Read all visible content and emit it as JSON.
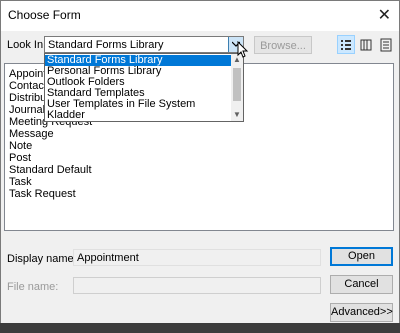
{
  "window": {
    "title": "Choose Form",
    "close_glyph": "✕"
  },
  "look_in": {
    "label": "Look In:",
    "value": "Standard Forms Library",
    "options": [
      "Standard Forms Library",
      "Personal Forms Library",
      "Outlook Folders",
      "Standard Templates",
      "User Templates in File System",
      "Kladder"
    ],
    "selected_index": 0
  },
  "browse_label": "Browse...",
  "view_buttons": [
    {
      "icon": "details-view-icon",
      "selected": true
    },
    {
      "icon": "list-view-icon",
      "selected": false
    },
    {
      "icon": "properties-view-icon",
      "selected": false
    }
  ],
  "forms_list": {
    "items": [
      "Appointment",
      "Contact",
      "Distribution List",
      "Journal Entry",
      "Meeting Request",
      "Message",
      "Note",
      "Post",
      "Standard Default",
      "Task",
      "Task Request"
    ],
    "obscured_texts": [
      "Appointn",
      "Contact",
      "Distributio",
      "Journal E",
      "Meeting Request"
    ]
  },
  "display_name": {
    "label": "Display name:",
    "value": "Appointment"
  },
  "file_name": {
    "label": "File name:",
    "value": ""
  },
  "buttons": {
    "open": "Open",
    "cancel": "Cancel",
    "advanced": "Advanced>>"
  },
  "colors": {
    "selection": "#0078d7",
    "default_button_border": "#0078d7"
  }
}
